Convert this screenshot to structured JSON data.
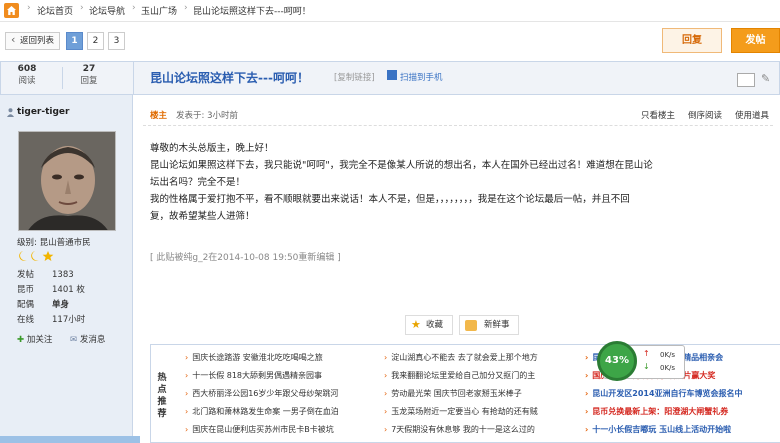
{
  "breadcrumb": {
    "items": [
      "论坛首页",
      "论坛导航",
      "玉山广场",
      "昆山论坛照这样下去---呵呵！"
    ],
    "separator": "›"
  },
  "toolbar": {
    "back_label": "返回列表",
    "pages": [
      "1",
      "2",
      "3"
    ],
    "current_page": "1",
    "reply_label": "回复",
    "newpost_label": "发帖"
  },
  "thread_stats": {
    "views": "608",
    "views_label": "阅读",
    "replies": "27",
    "replies_label": "回复"
  },
  "thread": {
    "title": "昆山论坛照这样下去---呵呵！",
    "copy_link": "[复制链接]",
    "scan_label": "扫描到手机"
  },
  "user": {
    "name": "tiger-tiger",
    "level_label": "级别: 昆山普通市民",
    "profile": [
      {
        "key": "发帖",
        "value": "1383"
      },
      {
        "key": "昆币",
        "value": "1401 枚"
      },
      {
        "key": "配偶",
        "value": "单身"
      },
      {
        "key": "在线",
        "value": "117小时"
      }
    ],
    "follow_label": "加关注",
    "message_label": "发消息"
  },
  "post": {
    "role": "楼主",
    "time": "发表于: 3小时前",
    "tools": [
      "只看楼主",
      "倒序阅读",
      "使用道具"
    ],
    "lines": [
      "  尊敬的木头总版主，晚上好！",
      "    昆山论坛如果照这样下去，我只能说\"呵呵\"，我完全不是像某人所说的想出名，本人在国外已经出过名！难道想在昆山论",
      "坛出名吗？完全不是！",
      "我的性格属于爱打抱不平，看不顺眼就要出来说话！本人不是，但是，，，，，，，，我是在这个论坛最后一帖，并且不回",
      "复，故希望某些人进筛！"
    ],
    "edit_note": "[ 此贴被纯g_2在2014-10-08 19:50重新编辑 ]",
    "favorite_label": "收藏",
    "fresh_label": "新鲜事"
  },
  "hot_topics": {
    "label": "热点推荐",
    "col1": [
      "国庆长途踏游 安徽淮北吃吃喝喝之旅",
      "十一长假 818大舔剩男偶遇精亲园事",
      "西大桥丽泽公园16岁少年跟父母纱架跳河",
      "北门路和萧林路发生命案 一男子倒在血泊",
      "国庆在昆山便利店买苏州市民卡B卡被坑"
    ],
    "col2": [
      "淀山湖真心不能去 去了就会爱上那个地方",
      "我来翻翻论坛里爱给自己加分又抠门的主",
      "劳动最光荣 国庆节回老家掰玉米棒子",
      "玉龙菜场附近一定要当心 有抢劫的还有贼",
      "7天假期没有休息够 我的十一是这么过的"
    ],
    "col3": [
      "昆山圈客 昆山瑜伽馆线下精品相亲会",
      "国庆7天乐 秀玩乐秀 晒照片赢大奖",
      "昆山开发区2014亚洲自行车博览会报名中",
      "昆币兑换最新上架：阳澄湖大闸蟹礼券",
      "十一小长假吉嘟玩 玉山线上活动开始啦"
    ]
  },
  "net_widget": {
    "percent": "43%",
    "up": "0K/s",
    "down": "0K/s"
  },
  "colors": {
    "accent_orange": "#f49c1b",
    "title_blue": "#2a5db0",
    "sidebar_bg": "#e8eef6"
  }
}
